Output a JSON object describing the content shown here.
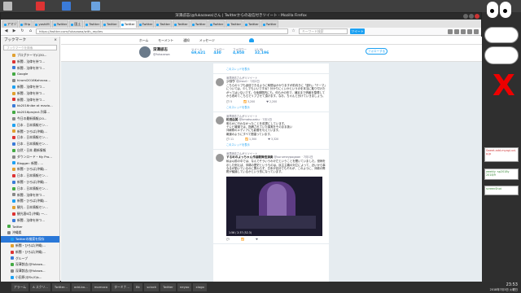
{
  "window": {
    "title": "深澤諒志(@fukazawa)さん | Twitterからの返信付きツイート - Mozilla Firefox"
  },
  "tabs": [
    "アマゾ",
    "ITrip",
    "yoshiM",
    "Twitter",
    "国土",
    "Twitter",
    "Twitter",
    "Twitter",
    "Twitter",
    "Twitter",
    "Twitter",
    "Twitter",
    "Twitter",
    "Twitter",
    "Twitter",
    "Twitter"
  ],
  "nav": {
    "url": "https://twitter.com/fukazawa/with_replies",
    "search_placeholder": "キーワード検索",
    "search_button": "ツイート"
  },
  "sidebar": {
    "title": "ブックマーク",
    "close": "×",
    "search_placeholder": "ブックマークを検索",
    "items": [
      "ブログテーマ(CJ30...",
      "新聞 - 法律を持つ...",
      "新聞 - 法律を持つ...",
      "Google",
      "hiromi2016Kahrona...",
      "新聞 - 法律を持つ...",
      "新聞 - 法律を持つ...",
      "新聞 - 法律を持つ...",
      "kb2016nibe at mazio...",
      "kb2016project-列車...",
      "今日の最新情報(20...",
      "日本 - 日本情報セン...",
      "新聞・ひろば(沖縄)...",
      "日本 - 日本情報セン...",
      "日本 - 日本情報セン...",
      "自然・日本 最新情報",
      "ダウンロード・My Pro...",
      "Blogger: 新聞 - ...",
      "新聞・ひろば(沖縄)...",
      "日本 - 日本情報セン...",
      "新聞・ひろば(沖縄)...",
      "日本 - 日本情報セン...",
      "新聞 - 法律を持つ...",
      "新聞・ひろば(沖縄)...",
      "観光 - 日本情報セン...",
      "観光客6月(沖縄) 一...",
      "新聞 - 法律を持つ...",
      "Twitter",
      "沖縄県",
      "Twitterの検索を保存",
      "新聞・ひろば(沖縄)...",
      "新聞・ひろば(沖縄)...",
      "グループ",
      "深澤諒志(@fukaza...",
      "深澤諒志(@fukaza...",
      "小田原(@Sn/Ojs...",
      "ドホチ(@fuhlokuno...",
      "グループ",
      "松本正男(@fukaz...",
      "高谷早町 Yoji Oo..."
    ],
    "selected_index": 29
  },
  "profile": {
    "nav": [
      "ホーム",
      "モーメント",
      "通知",
      "メッセージ"
    ],
    "name": "深澤諒志",
    "handle": "@fukazawa",
    "stats": [
      {
        "label": "ツイート",
        "value": "69,621"
      },
      {
        "label": "フォロー",
        "value": "430"
      },
      {
        "label": "フォロワー",
        "value": "4,958"
      },
      {
        "label": "いいね",
        "value": "32,196"
      }
    ],
    "follow": "フォローする"
  },
  "tweets": [
    {
      "thread": "このスレッドを表示"
    },
    {
      "rt": "深澤諒志さんがリツイート",
      "name": "ジロウ",
      "handle": "@jirou0 · 7月2日",
      "body": "こちらのリプも返信できるように時間はかかりますが前向きに「遅れ」「テーマ」については、少しでもいいですね？分かりにくいかというのを本当に取り付けたがってはいないです。今後期間内にも、何らかの形で、補足まで情報を整理してから改めてこちらでリプさせて頂けます。なお、ちゃんと分けていきましょう。",
      "acts": [
        "5",
        "3,200",
        "2,200"
      ],
      "thread": "このスレッドを表示"
    },
    {
      "rt": "深澤諒志さんがリツイート",
      "name": "松田由美",
      "handle": "@kmatsuzaku · 7月1日",
      "body": "明らかに行わなかったことを前提にしています。\nテレビ報道では、指摘されていた事実をそのまま扱い\n沖縄県のメディアにも影響を与えています。\n報道のようにすべて間違っています。",
      "acts": [
        "11",
        "1,300",
        "3,320"
      ],
      "thread": "このスレッドを表示"
    },
    {
      "rt": "深澤諒志さんがリツイート",
      "name": "するめのよっちゃん作曲歌舞伎演奏",
      "handle": "@surumeypogaan · 7月1日",
      "body": "私は以前の中では、なんでそういうわけだということを聞いていました。役柄を示した例えば、沖縄の歴史というものは、民主主義の対立によって、近いから事なるが動いているのに関わらず、日本が自分でもそれが、このように、沖縄の問題が議論しているかという形になっています。",
      "video": "1:56 / 2:37 (52.3)",
      "acts": [
        "",
        "",
        ""
      ]
    }
  ],
  "taskbar": [
    "アラーム",
    "A スクリ...",
    "Twitter...",
    "add-bo...",
    "momoco",
    "ターミナ...",
    "Bt:",
    "sclock",
    "Twitter",
    "neyoo",
    "xlogo"
  ],
  "clock": {
    "time": "23:53",
    "date": "2018年7月3日 火曜日"
  },
  "widgets": {
    "w1": "Sweet-add-myogi-uxi-g.jp",
    "w2": "weekly ·sp2018y 2018/9",
    "w3": "screenShot"
  },
  "bigx": "X"
}
